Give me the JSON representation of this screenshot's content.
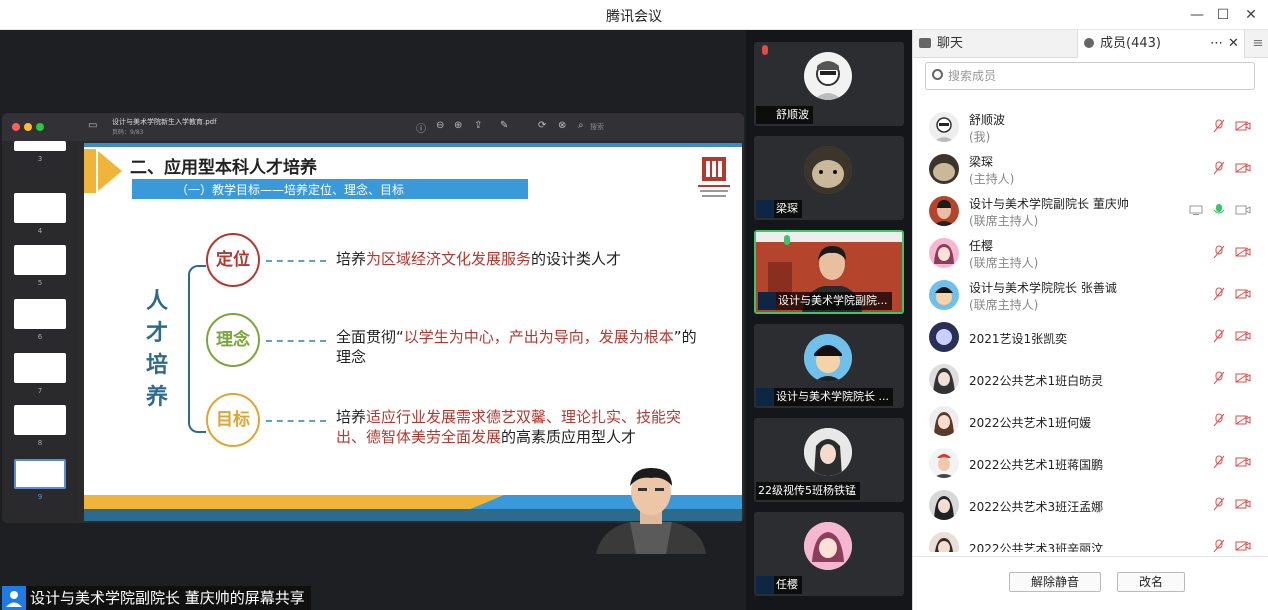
{
  "window": {
    "title": "腾讯会议"
  },
  "share": {
    "pdf_filename": "设计与美术学院新生入学教育.pdf",
    "pdf_page_info": "页码：9/83",
    "search_placeholder": "搜索",
    "thumbnail_pages": [
      "3",
      "4",
      "5",
      "6",
      "7",
      "8",
      "9"
    ],
    "status_label": "设计与美术学院副院长  董庆帅的屏幕共享"
  },
  "slide": {
    "heading": "二、应用型本科人才培养",
    "subheading": "（一）教学目标——培养定位、理念、目标",
    "left_chars": [
      "人",
      "才",
      "培",
      "养"
    ],
    "items": [
      {
        "circle": "定位",
        "text_a": "培养",
        "text_red": "为区域经济文化发展服务",
        "text_b": "的设计类人才",
        "color": "#b5372e"
      },
      {
        "circle": "理念",
        "text_a": "全面贯彻“",
        "text_red": "以学生为中心，产出为导向，发展为根本",
        "text_b": "”的理念",
        "color": "#7aa63a"
      },
      {
        "circle": "目标",
        "text_a": "培养",
        "text_red": "适应行业发展需求德艺双馨、理论扎实、技能突出、德智体美劳全面发展",
        "text_b": "的高素质应用型人才",
        "color": "#e0a530"
      }
    ]
  },
  "videos": [
    {
      "name": "舒顺波",
      "muted": true
    },
    {
      "name": "梁琛",
      "muted": true
    },
    {
      "name": "设计与美术学院副院...",
      "muted": false,
      "active": true
    },
    {
      "name": "设计与美术学院院长 ...",
      "muted": true
    },
    {
      "name": "22级视传5班杨铁锰",
      "muted": true
    },
    {
      "name": "任樱",
      "muted": true
    }
  ],
  "panel": {
    "tab_chat": "聊天",
    "tab_members": "成员(443)",
    "search_placeholder": "搜索成员",
    "members": [
      {
        "name": "舒顺波",
        "role": "(我)"
      },
      {
        "name": "梁琛",
        "role": "(主持人)"
      },
      {
        "name": "设计与美术学院副院长  董庆帅",
        "role": "(联席主持人)",
        "sharing": true,
        "mic_on": true
      },
      {
        "name": "任樱",
        "role": "(联席主持人)"
      },
      {
        "name": "设计与美术学院院长 张善诚",
        "role": "(联席主持人)"
      },
      {
        "name": "2021艺设1张凯奕",
        "role": ""
      },
      {
        "name": "2022公共艺术1班白昉灵",
        "role": ""
      },
      {
        "name": "2022公共艺术1班何媛",
        "role": ""
      },
      {
        "name": "2022公共艺术1班蒋国鹏",
        "role": ""
      },
      {
        "name": "2022公共艺术3班汪孟娜",
        "role": ""
      },
      {
        "name": "2022公共艺术3班辛丽汶",
        "role": ""
      }
    ],
    "btn_unmute": "解除静音",
    "btn_rename": "改名"
  },
  "colors": {
    "accent_green": "#3cc36b",
    "muted_red": "#e04b4b",
    "host_blue": "#2a7fe0"
  }
}
